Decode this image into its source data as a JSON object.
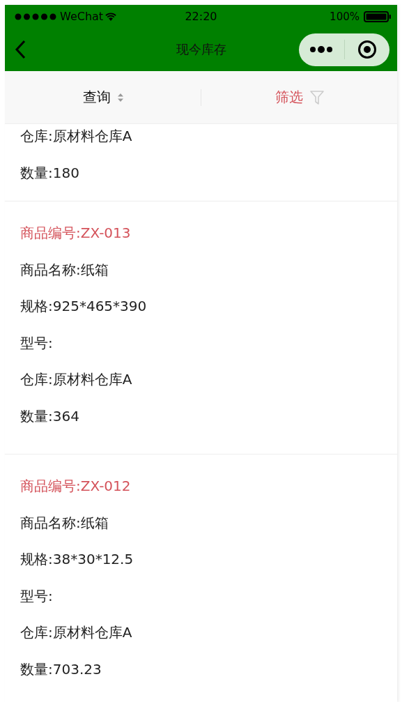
{
  "status_bar": {
    "carrier": "WeChat",
    "time": "22:20",
    "battery": "100%"
  },
  "nav_bar": {
    "title": "现今库存"
  },
  "filter_bar": {
    "query": "查询",
    "filter": "筛选"
  },
  "cards": [
    {
      "lines": [
        "仓库:原材料仓库A",
        "数量:180"
      ]
    },
    {
      "code": "商品编号:ZX-013",
      "lines": [
        "商品名称:纸箱",
        "规格:925*465*390",
        "型号:",
        "仓库:原材料仓库A",
        "数量:364"
      ]
    },
    {
      "code": "商品编号:ZX-012",
      "lines": [
        "商品名称:纸箱",
        "规格:38*30*12.5",
        "型号:",
        "仓库:原材料仓库A",
        "数量:703.23"
      ]
    }
  ]
}
